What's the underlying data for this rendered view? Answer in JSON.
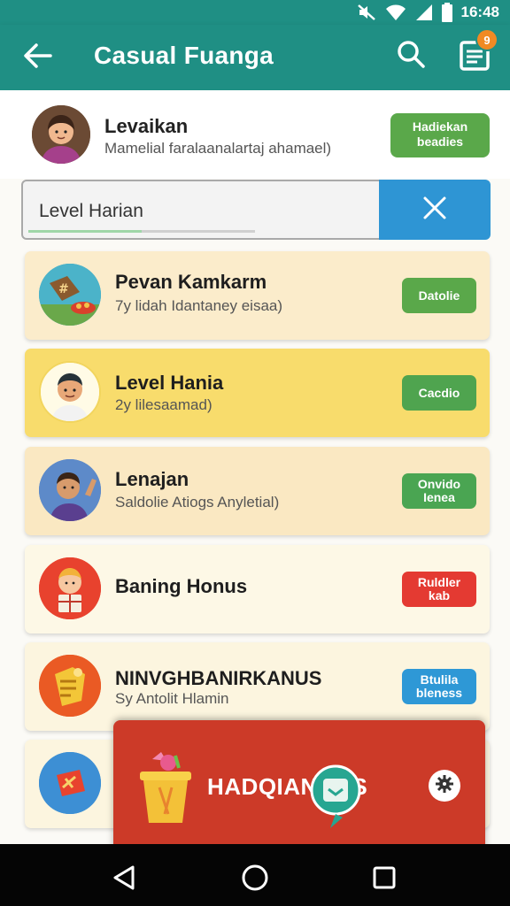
{
  "status_bar": {
    "time": "16:48"
  },
  "app_bar": {
    "title": "Casual Fuanga",
    "notification_count": "9",
    "icons": [
      "back-arrow-icon",
      "search-icon",
      "notes-icon"
    ]
  },
  "profile": {
    "name": "Levaikan",
    "subtitle": "Mamelial faralaanalartaj ahamael)",
    "button_label": "Hadiekan\nbeadies"
  },
  "search": {
    "value": "Level Harian",
    "progress": 0.5
  },
  "items": [
    {
      "title": "Pevan Kamkarm",
      "subtitle": "7y lidah Idantaney eisaa)",
      "button": "Datolie",
      "button_color": "#5aa84a",
      "bg": "#fbeccb"
    },
    {
      "title": "Level Hania",
      "subtitle": "2y lilesaamad)",
      "button": "Cacdio",
      "button_color": "#4fa44f",
      "bg": "#f8dc6c"
    },
    {
      "title": "Lenajan",
      "subtitle": "Saldolie Atiogs Anyletial)",
      "button": "Onvido\nIenea",
      "button_color": "#4aa552",
      "bg": "#fae8c2"
    },
    {
      "title": "Baning Honus",
      "subtitle": "",
      "button": "Ruldler\nkab",
      "button_color": "#e43a32",
      "bg": "#fdf8e6"
    },
    {
      "title": "NINVGHBANIRKANUS",
      "subtitle": "Sy Antolit Hlamin",
      "button": "Btulila\nbleness",
      "button_color": "#2e98d6",
      "bg": "#fcf5df"
    },
    {
      "title": "",
      "subtitle": "",
      "button": "",
      "button_color": "",
      "bg": "#fcf5df"
    }
  ],
  "banner": {
    "text": "HADQIANNUS"
  },
  "colors": {
    "primary": "#1f8f84",
    "accent": "#f08a24",
    "banner": "#cc3a28"
  }
}
